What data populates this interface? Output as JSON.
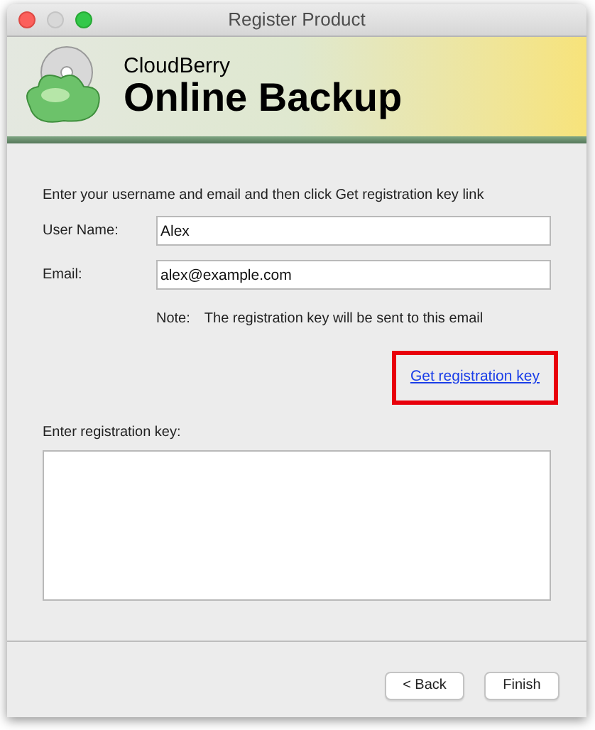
{
  "window": {
    "title": "Register Product"
  },
  "banner": {
    "brand": "CloudBerry",
    "product": "Online Backup"
  },
  "instructions": "Enter your username and email and then click Get registration key link",
  "fields": [
    {
      "label": "User Name:",
      "value": "Alex"
    },
    {
      "label": "Email:",
      "value": "alex@example.com"
    }
  ],
  "note": {
    "label": "Note:",
    "text": "The registration key will be sent to this email"
  },
  "link": {
    "label": "Get registration key",
    "highlighted": true
  },
  "key_field": {
    "label": "Enter registration key:"
  },
  "buttons": [
    "< Back",
    "Finish"
  ]
}
